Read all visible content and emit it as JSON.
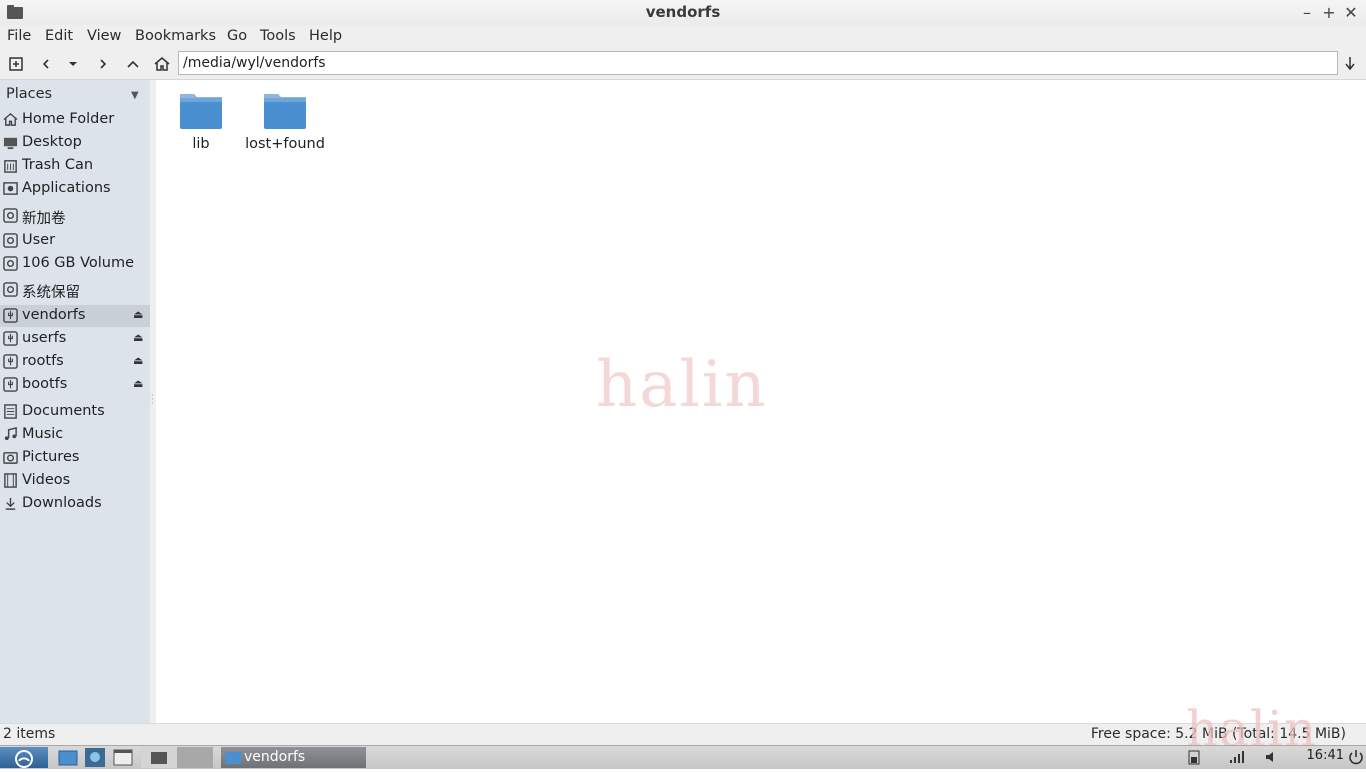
{
  "window": {
    "title": "vendorfs"
  },
  "menu": [
    "File",
    "Edit",
    "View",
    "Bookmarks",
    "Go",
    "Tools",
    "Help"
  ],
  "toolbar": {
    "path": "/media/wyl/vendorfs"
  },
  "sidebar": {
    "header": "Places",
    "items": [
      {
        "label": "Home Folder",
        "icon": "home-icon"
      },
      {
        "label": "Desktop",
        "icon": "desktop-icon"
      },
      {
        "label": "Trash Can",
        "icon": "trash-icon"
      },
      {
        "label": "Applications",
        "icon": "applications-icon"
      },
      {
        "label": "新加卷",
        "icon": "drive-icon"
      },
      {
        "label": "User",
        "icon": "drive-icon"
      },
      {
        "label": "106 GB Volume",
        "icon": "drive-icon"
      },
      {
        "label": "系统保留",
        "icon": "drive-icon"
      },
      {
        "label": "vendorfs",
        "icon": "usb-drive-icon",
        "selected": true,
        "eject": true
      },
      {
        "label": "userfs",
        "icon": "usb-drive-icon",
        "eject": true
      },
      {
        "label": "rootfs",
        "icon": "usb-drive-icon",
        "eject": true
      },
      {
        "label": "bootfs",
        "icon": "usb-drive-icon",
        "eject": true
      },
      {
        "label": "Documents",
        "icon": "documents-icon"
      },
      {
        "label": "Music",
        "icon": "music-icon"
      },
      {
        "label": "Pictures",
        "icon": "pictures-icon"
      },
      {
        "label": "Videos",
        "icon": "videos-icon"
      },
      {
        "label": "Downloads",
        "icon": "downloads-icon"
      }
    ]
  },
  "files": [
    {
      "name": "lib",
      "type": "folder"
    },
    {
      "name": "lost+found",
      "type": "folder"
    }
  ],
  "status": {
    "items": "2 items",
    "free_space": "Free space: 5.2 MiB (Total: 14.5 MiB)"
  },
  "watermark": "halin",
  "taskbar": {
    "window_label": "vendorfs",
    "clock": "16:41"
  },
  "colors": {
    "sidebar_bg": "#dde3ea",
    "selected_bg": "#c9d0d8",
    "folder_blue": "#4a8fd0",
    "watermark": "#f0c0c0"
  }
}
